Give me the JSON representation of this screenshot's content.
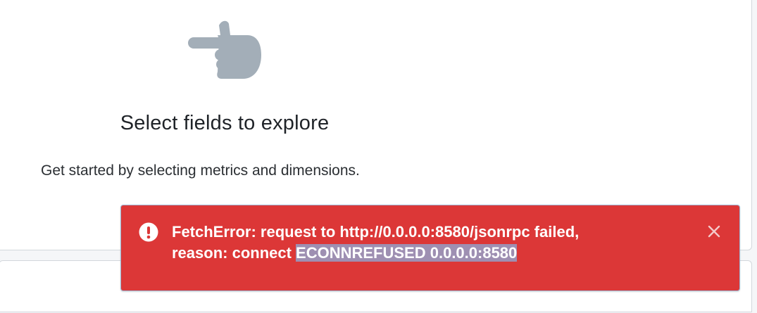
{
  "empty_state": {
    "icon": "pointing-hand-icon",
    "title": "Select fields to explore",
    "subtitle": "Get started by selecting metrics and dimensions."
  },
  "toast": {
    "icon": "exclamation-circle-icon",
    "message_line1": "FetchError: request to http://0.0.0.0:8580/jsonrpc failed,",
    "message_line2_prefix": "reason: connect ",
    "message_line2_selected": "ECONNREFUSED 0.0.0.0:8580",
    "close_icon": "close-icon",
    "background_color": "#dc3737",
    "selection_color": "#9e8fb2"
  }
}
